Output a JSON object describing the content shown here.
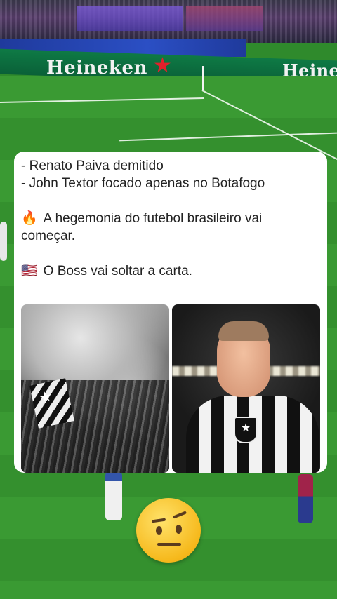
{
  "background": {
    "ad_board_text_left": "Heineken",
    "ad_board_text_right": "Heineke",
    "ad_star_color": "#e0212b",
    "pitch_color": "#3a9a33"
  },
  "post": {
    "lines": [
      "- Renato Paiva demitido",
      "- John Textor focado apenas no Botafogo"
    ],
    "fire_emoji": "🔥",
    "paragraph_1": "A hegemonia do futebol brasileiro vai",
    "paragraph_1_cont": "começar.",
    "flag_emoji": "🇺🇸",
    "paragraph_2": "O Boss vai soltar a carta.",
    "images": [
      {
        "name": "botafogo-fans-photo",
        "icon": "crowd-with-flag"
      },
      {
        "name": "john-textor-photo",
        "icon": "man-in-botafogo-jersey"
      }
    ]
  },
  "reaction": {
    "icon": "face-with-raised-eyebrow-icon"
  }
}
